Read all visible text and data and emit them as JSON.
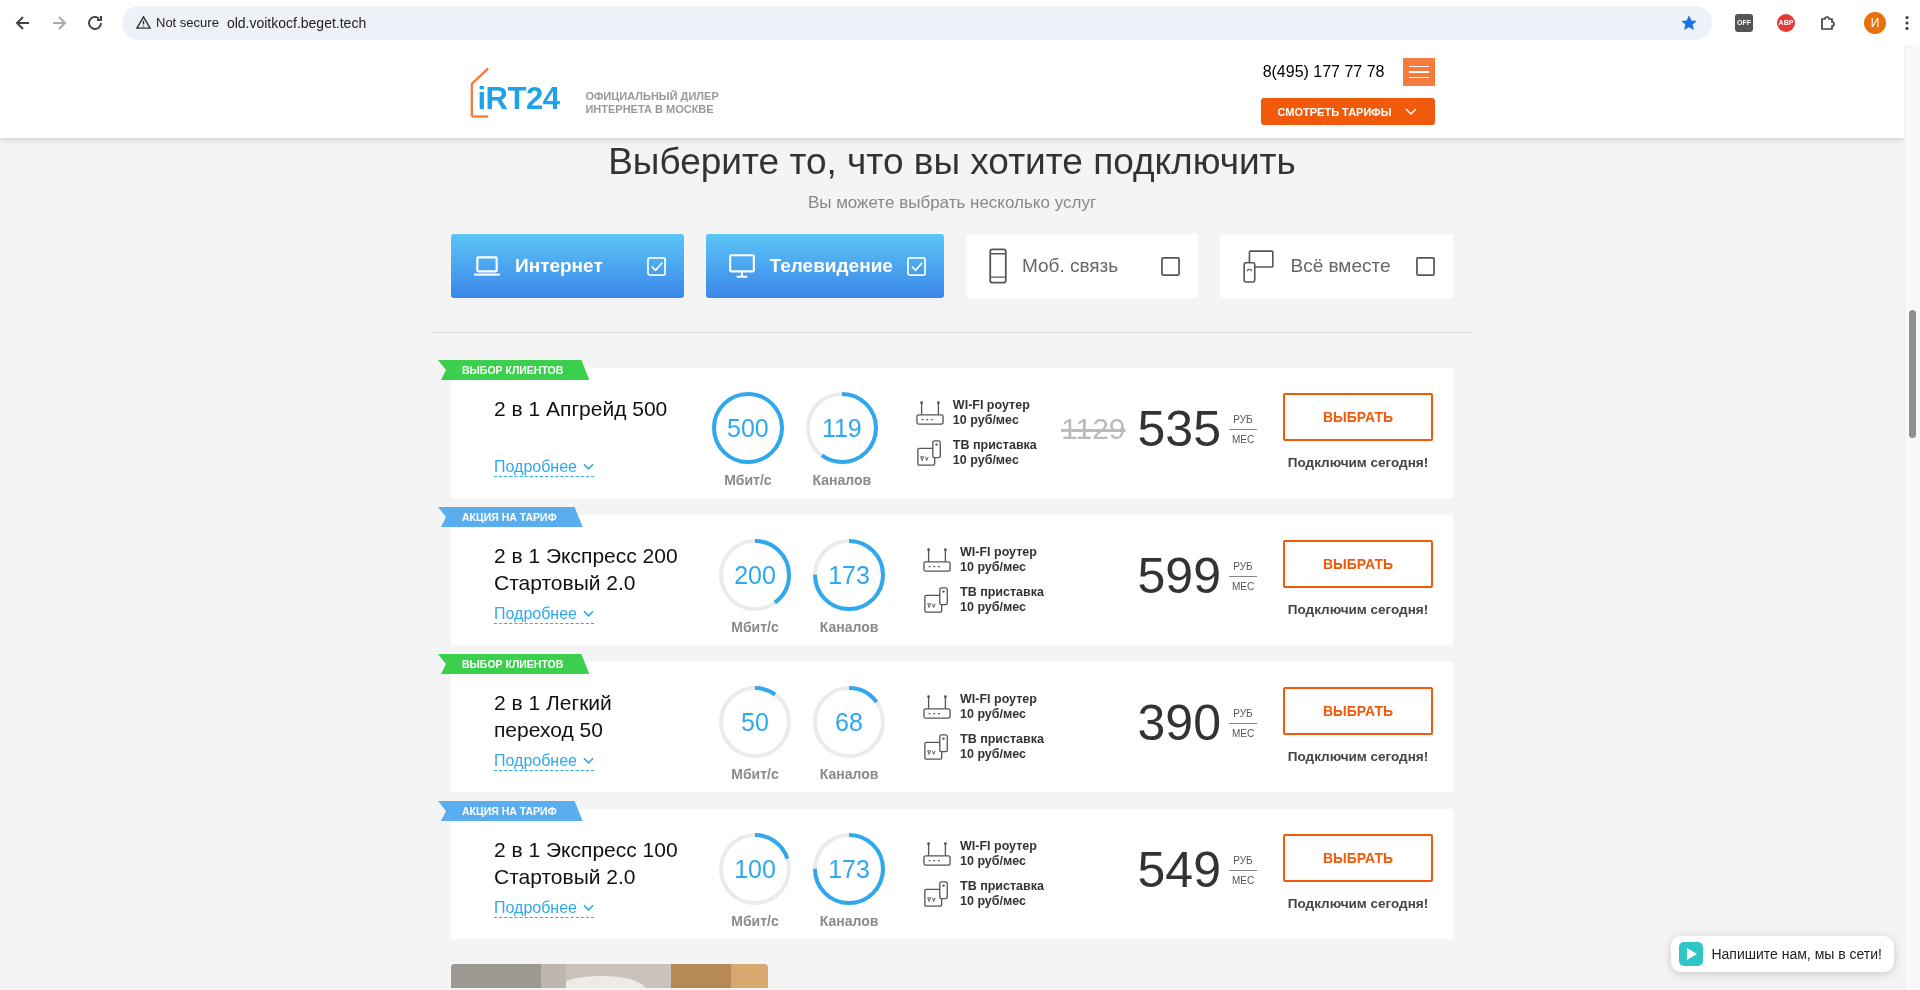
{
  "browser": {
    "security": "Not secure",
    "url": "old.voitkocf.beget.tech",
    "extensions": [
      "OFF",
      "ABP"
    ],
    "profile_initial": "И"
  },
  "header": {
    "logo": "iRT24",
    "tagline": [
      "ОФИЦИАЛЬНЫЙ ДИЛЕР",
      "ИНТЕРНЕТА В МОСКВЕ"
    ],
    "phone": "8(495) 177 77 78",
    "tariffs_button": "СМОТРЕТЬ ТАРИФЫ"
  },
  "section": {
    "title": "Выберите то, что вы хотите подключить",
    "subtitle": "Вы можете выбрать несколько услуг"
  },
  "services": [
    {
      "kind": "laptop",
      "label": "Интернет",
      "selected": true
    },
    {
      "kind": "monitor",
      "label": "Телевидение",
      "selected": true
    },
    {
      "kind": "phone",
      "label": "Моб. связь",
      "selected": false
    },
    {
      "kind": "devices",
      "label": "Всё вместе",
      "selected": false
    }
  ],
  "tariffs": [
    {
      "badge": {
        "text": "ВЫБОР КЛИЕНТОВ",
        "color": "#3ccf4e"
      },
      "name_lines": [
        "2 в 1 Апгрейд 500"
      ],
      "more": "Подробнее",
      "speed": {
        "value": "500",
        "unit": "Мбит/с",
        "level": 1
      },
      "channels": {
        "value": "119",
        "unit": "Каналов",
        "level": 0.6
      },
      "extras": [
        {
          "kind": "router",
          "label": "WI-FI роутер",
          "price": "10 руб/мес"
        },
        {
          "kind": "tv-box",
          "label": "ТВ приставка",
          "price": "10 руб/мес"
        }
      ],
      "old_price": "1129",
      "price": "535",
      "currency": "РУБ",
      "period": "МЕС",
      "button": "ВЫБРАТЬ",
      "note": "Подключим сегодня!"
    },
    {
      "badge": {
        "text": "АКЦИЯ НА ТАРИФ",
        "color": "#5aaef0"
      },
      "name_lines": [
        "2 в 1 Экспресс 200",
        "Стартовый 2.0"
      ],
      "more": "Подробнее",
      "speed": {
        "value": "200",
        "unit": "Мбит/с",
        "level": 0.4
      },
      "channels": {
        "value": "173",
        "unit": "Каналов",
        "level": 0.75
      },
      "extras": [
        {
          "kind": "router",
          "label": "WI-FI роутер",
          "price": "10 руб/мес"
        },
        {
          "kind": "tv-box",
          "label": "ТВ приставка",
          "price": "10 руб/мес"
        }
      ],
      "price": "599",
      "currency": "РУБ",
      "period": "МЕС",
      "button": "ВЫБРАТЬ",
      "note": "Подключим сегодня!"
    },
    {
      "badge": {
        "text": "ВЫБОР КЛИЕНТОВ",
        "color": "#3ccf4e"
      },
      "name_lines": [
        "2 в 1 Легкий",
        "переход 50"
      ],
      "more": "Подробнее",
      "speed": {
        "value": "50",
        "unit": "Мбит/с",
        "level": 0.1
      },
      "channels": {
        "value": "68",
        "unit": "Каналов",
        "level": 0.15
      },
      "extras": [
        {
          "kind": "router",
          "label": "WI-FI роутер",
          "price": "10 руб/мес"
        },
        {
          "kind": "tv-box",
          "label": "ТВ приставка",
          "price": "10 руб/мес"
        }
      ],
      "price": "390",
      "currency": "РУБ",
      "period": "МЕС",
      "button": "ВЫБРАТЬ",
      "note": "Подключим сегодня!"
    },
    {
      "badge": {
        "text": "АКЦИЯ НА ТАРИФ",
        "color": "#5aaef0"
      },
      "name_lines": [
        "2 в 1 Экспресс 100",
        "Стартовый 2.0"
      ],
      "more": "Подробнее",
      "speed": {
        "value": "100",
        "unit": "Мбит/с",
        "level": 0.2
      },
      "channels": {
        "value": "173",
        "unit": "Каналов",
        "level": 0.75
      },
      "extras": [
        {
          "kind": "router",
          "label": "WI-FI роутер",
          "price": "10 руб/мес"
        },
        {
          "kind": "tv-box",
          "label": "ТВ приставка",
          "price": "10 руб/мес"
        }
      ],
      "price": "549",
      "currency": "РУБ",
      "period": "МЕС",
      "button": "ВЫБРАТЬ",
      "note": "Подключим сегодня!"
    }
  ],
  "chat": {
    "text": "Напишите нам, мы в сети!"
  }
}
